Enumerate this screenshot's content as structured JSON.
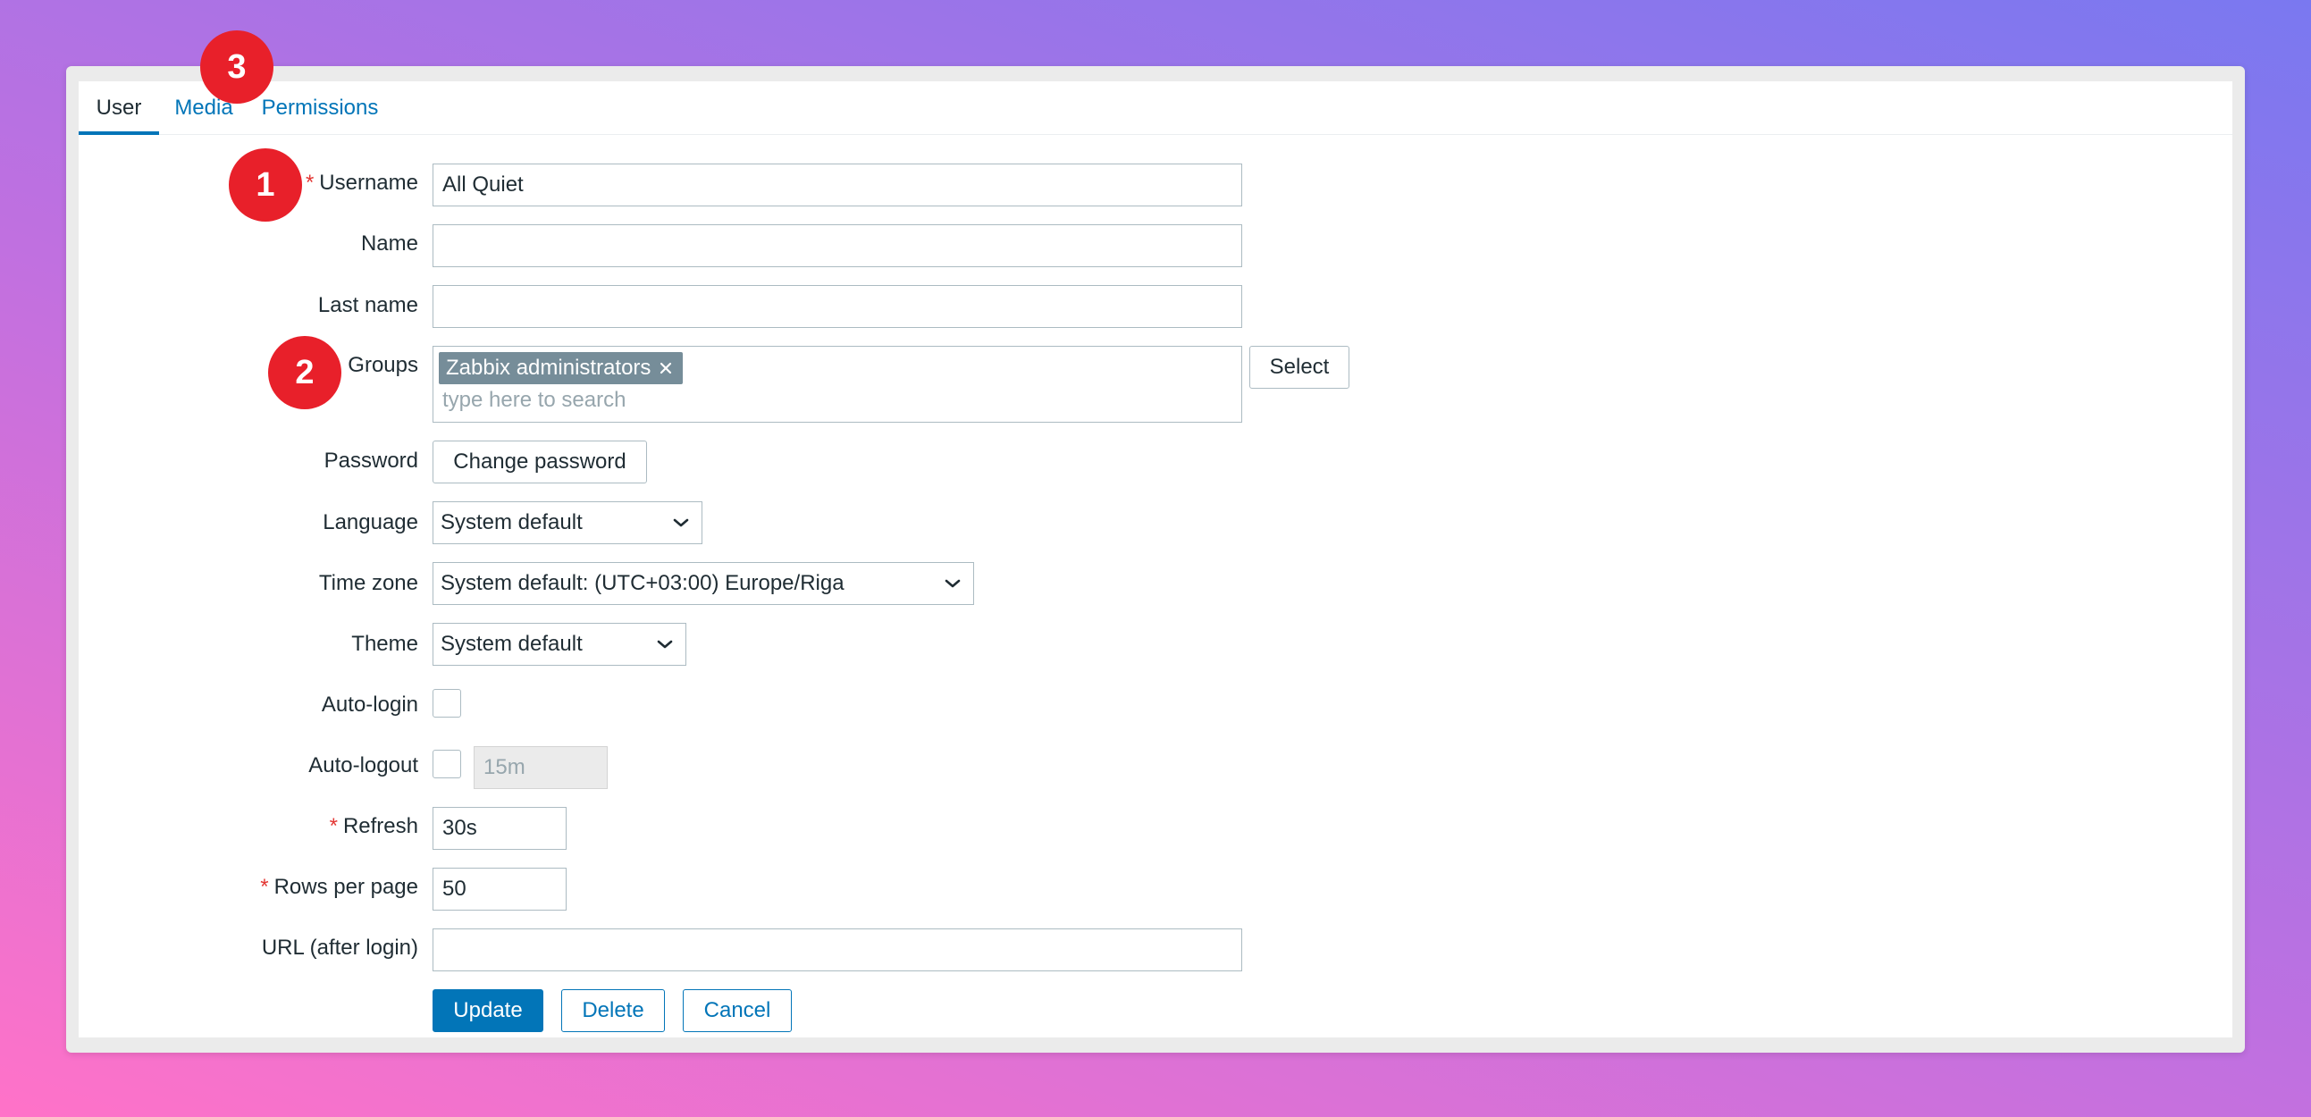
{
  "tabs": [
    {
      "label": "User",
      "active": true
    },
    {
      "label": "Media",
      "active": false
    },
    {
      "label": "Permissions",
      "active": false
    }
  ],
  "badges": [
    "1",
    "2",
    "3"
  ],
  "form": {
    "username": {
      "label": "Username",
      "value": "All Quiet",
      "required": "*"
    },
    "name": {
      "label": "Name",
      "value": ""
    },
    "last_name": {
      "label": "Last name",
      "value": ""
    },
    "groups": {
      "label": "Groups",
      "chips": [
        "Zabbix administrators"
      ],
      "placeholder": "type here to search",
      "select_label": "Select"
    },
    "password": {
      "label": "Password",
      "button": "Change password"
    },
    "language": {
      "label": "Language",
      "value": "System default"
    },
    "timezone": {
      "label": "Time zone",
      "value": "System default: (UTC+03:00) Europe/Riga"
    },
    "theme": {
      "label": "Theme",
      "value": "System default"
    },
    "autologin": {
      "label": "Auto-login",
      "checked": false
    },
    "autologout": {
      "label": "Auto-logout",
      "checked": false,
      "value": "15m"
    },
    "refresh": {
      "label": "Refresh",
      "value": "30s",
      "required": "*"
    },
    "rows_per_page": {
      "label": "Rows per page",
      "value": "50",
      "required": "*"
    },
    "url": {
      "label": "URL (after login)",
      "value": ""
    }
  },
  "actions": {
    "update": "Update",
    "delete": "Delete",
    "cancel": "Cancel"
  },
  "colors": {
    "accent": "#0275b8",
    "badge": "#e8202a",
    "required": "#e33734"
  },
  "icons": [
    "chevron-down-icon",
    "remove-x-icon"
  ]
}
